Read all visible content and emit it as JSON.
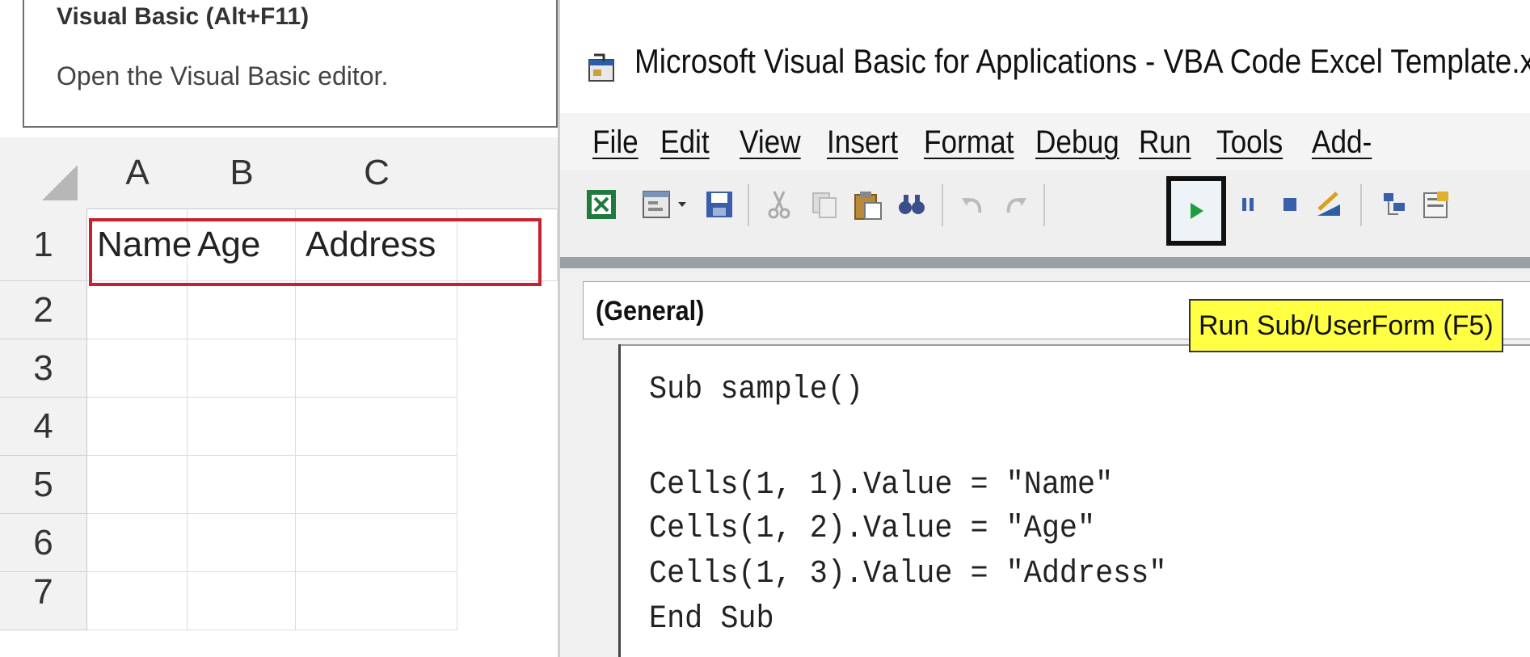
{
  "tooltip": {
    "title": "Visual Basic (Alt+F11)",
    "description": "Open the Visual Basic editor."
  },
  "sheet": {
    "columns": [
      "A",
      "B",
      "C"
    ],
    "rows": [
      "1",
      "2",
      "3",
      "4",
      "5",
      "6",
      "7"
    ],
    "cells": {
      "A1": "Name",
      "B1": "Age",
      "C1": "Address"
    },
    "selection_color": "#c8202e"
  },
  "vba": {
    "title": "Microsoft Visual Basic for Applications - VBA Code Excel Template.xl",
    "menu": [
      "File",
      "Edit",
      "View",
      "Insert",
      "Format",
      "Debug",
      "Run",
      "Tools",
      "Add-"
    ],
    "toolbar_icons": [
      "excel-icon",
      "userform-icon",
      "dropdown-arrow-icon",
      "save-icon",
      "cut-icon",
      "copy-icon",
      "paste-icon",
      "find-icon",
      "undo-icon",
      "redo-icon",
      "run-icon",
      "pause-icon",
      "reset-icon",
      "design-mode-icon",
      "project-explorer-icon",
      "properties-icon"
    ],
    "object_combo": "(General)",
    "run_tooltip": "Run Sub/UserForm (F5)",
    "code": [
      "Sub sample()",
      "",
      "Cells(1, 1).Value = \"Name\"",
      "Cells(1, 2).Value = \"Age\"",
      "Cells(1, 3).Value = \"Address\"",
      "End Sub"
    ],
    "highlight_color": "#ffff44"
  }
}
